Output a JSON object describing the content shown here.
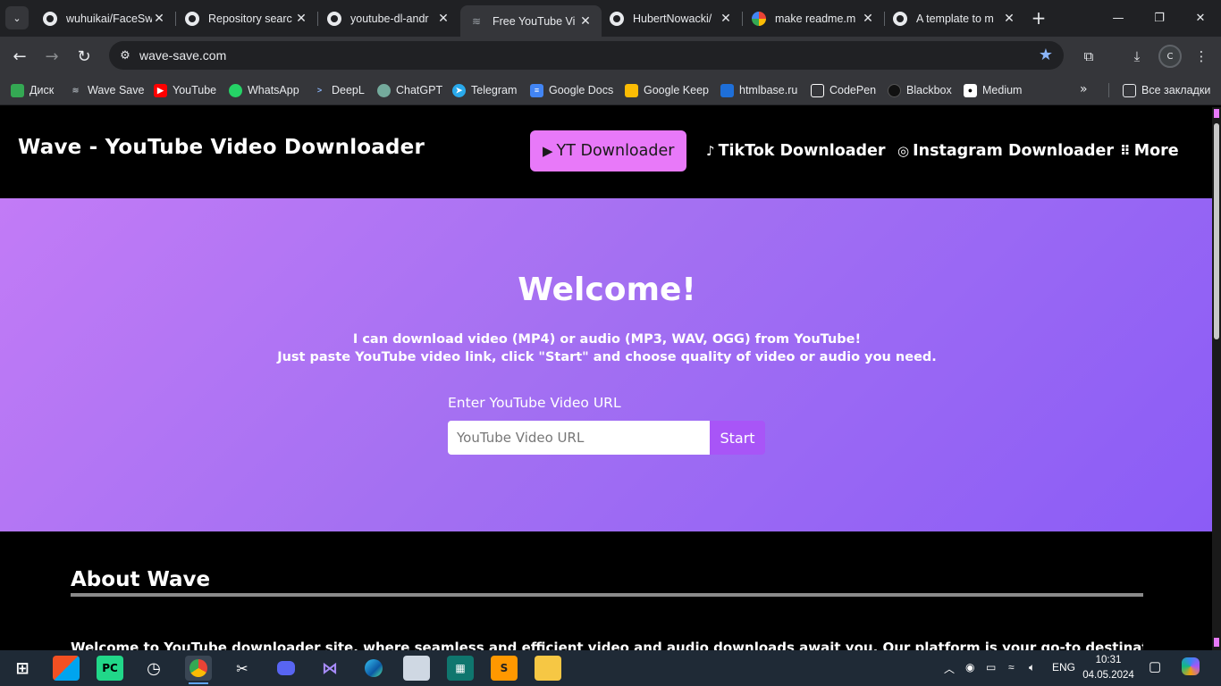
{
  "browser": {
    "tabs": [
      {
        "label": "wuhuikai/FaceSw",
        "favicon": "github-icon"
      },
      {
        "label": "Repository searc",
        "favicon": "github-icon"
      },
      {
        "label": "youtube-dl-andr",
        "favicon": "github-icon"
      },
      {
        "label": "Free YouTube Vi",
        "favicon": "wave-icon",
        "active": true
      },
      {
        "label": "HubertNowacki/",
        "favicon": "github-icon"
      },
      {
        "label": "make readme.m",
        "favicon": "google-icon"
      },
      {
        "label": "A template to m",
        "favicon": "github-icon"
      }
    ],
    "url": "wave-save.com",
    "profile_initial": "C",
    "bookmarks": [
      {
        "label": "Диск",
        "icon": "drive-icon",
        "color": "#34a853"
      },
      {
        "label": "Wave Save",
        "icon": "wave-icon",
        "color": "#9aa0a6"
      },
      {
        "label": "YouTube",
        "icon": "youtube-icon",
        "color": "#ff0000"
      },
      {
        "label": "WhatsApp",
        "icon": "whatsapp-icon",
        "color": "#25d366"
      },
      {
        "label": "DeepL",
        "icon": "deepl-icon",
        "color": "#0f2b46"
      },
      {
        "label": "ChatGPT",
        "icon": "chatgpt-icon",
        "color": "#74aa9c"
      },
      {
        "label": "Telegram",
        "icon": "telegram-icon",
        "color": "#29a9eb"
      },
      {
        "label": "Google Docs",
        "icon": "docs-icon",
        "color": "#4285f4"
      },
      {
        "label": "Google Keep",
        "icon": "keep-icon",
        "color": "#fbbc04"
      },
      {
        "label": "htmlbase.ru",
        "icon": "htmlbase-icon",
        "color": "#1e6fd9"
      },
      {
        "label": "CodePen",
        "icon": "codepen-icon",
        "color": "#ffffff"
      },
      {
        "label": "Blackbox",
        "icon": "blackbox-icon",
        "color": "#111111"
      },
      {
        "label": "Medium",
        "icon": "medium-icon",
        "color": "#ffffff"
      }
    ],
    "all_bookmarks_label": "Все закладки"
  },
  "site": {
    "brand": "Wave - YouTube Video Downloader",
    "nav": [
      {
        "label": "YT Downloader",
        "icon": "youtube-icon",
        "active": true
      },
      {
        "label": "TikTok Downloader",
        "icon": "tiktok-icon"
      },
      {
        "label": "Instagram Downloader",
        "icon": "instagram-icon"
      },
      {
        "label": "More",
        "icon": "grid-icon"
      }
    ],
    "hero": {
      "title": "Welcome!",
      "line1": "I can download video (MP4) or audio (MP3, WAV, OGG) from YouTube!",
      "line2": "Just paste YouTube video link, click \"Start\" and choose quality of video or audio you need.",
      "input_label": "Enter YouTube Video URL",
      "input_placeholder": "YouTube Video URL",
      "input_value": "",
      "button": "Start"
    },
    "about": {
      "title": "About Wave",
      "text": "Welcome to YouTube downloader site, where seamless and efficient video and audio downloads await you. Our platform is your go-to destination for all your"
    },
    "accent_color": "#e879f9",
    "hero_gradient": [
      "#c27bf6",
      "#8b5cf6"
    ]
  },
  "taskbar": {
    "apps": [
      "windows-start-icon",
      "microsoft-store-icon",
      "pycharm-icon",
      "clock-app-icon",
      "chrome-icon",
      "capcut-icon",
      "discord-icon",
      "visual-studio-icon",
      "edge-icon",
      "image-viewer-icon",
      "terminal-icon",
      "sublime-text-icon",
      "file-explorer-icon"
    ],
    "language": "ENG",
    "time": "10:31",
    "date": "04.05.2024"
  }
}
